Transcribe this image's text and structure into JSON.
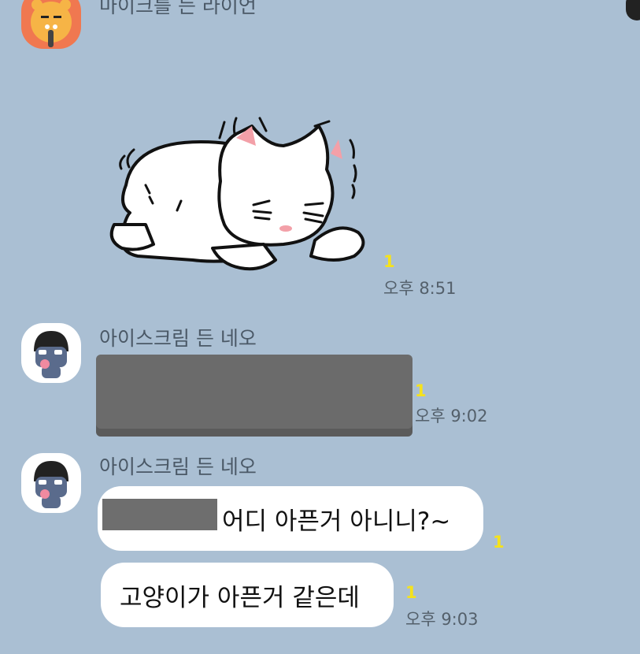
{
  "messages": [
    {
      "sender": "마이크를 든 라이언",
      "type": "sticker",
      "sticker": "crying-cat-sticker",
      "unread": "1",
      "time": "오후 8:51"
    },
    {
      "sender": "아이스크림 든 네오",
      "type": "image",
      "image": "redacted-image",
      "unread": "1",
      "time": "오후 9:02"
    },
    {
      "sender": "아이스크림 든 네오",
      "type": "text",
      "text": "어디 아픈거 아니니?~",
      "unread": "1"
    },
    {
      "type": "text",
      "text": "고양이가 아픈거 같은데",
      "unread": "1",
      "time": "오후 9:03"
    }
  ],
  "colors": {
    "chat_background": "#aabfd3",
    "unread_badge": "#f5e21c",
    "bubble": "#ffffff",
    "redaction": "#6e6e6e"
  }
}
